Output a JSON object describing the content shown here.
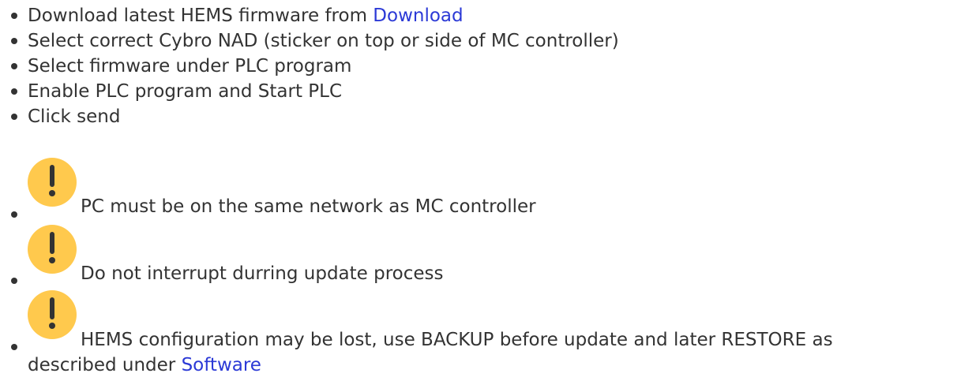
{
  "items": [
    {
      "text": "Download latest HEMS firmware from ",
      "link": "Download"
    },
    {
      "text": "Select correct Cybro NAD (sticker on top or side of MC controller)"
    },
    {
      "text": "Select firmware under PLC program"
    },
    {
      "text": "Enable PLC program and Start PLC"
    },
    {
      "text": "Click send"
    }
  ],
  "notes": [
    {
      "icon": "exclamation-icon",
      "text": "PC must be on the same network as MC controller"
    },
    {
      "icon": "exclamation-icon",
      "text": "Do not interrupt durring update process"
    },
    {
      "icon": "exclamation-icon",
      "text": "HEMS configuration may be lost, use BACKUP before update and later RESTORE as",
      "text_cont": "described under ",
      "link": "Software"
    }
  ],
  "colors": {
    "text": "#333333",
    "link": "#2b39d6",
    "warning_icon": "#ffc94d",
    "warning_mark": "#333333"
  }
}
